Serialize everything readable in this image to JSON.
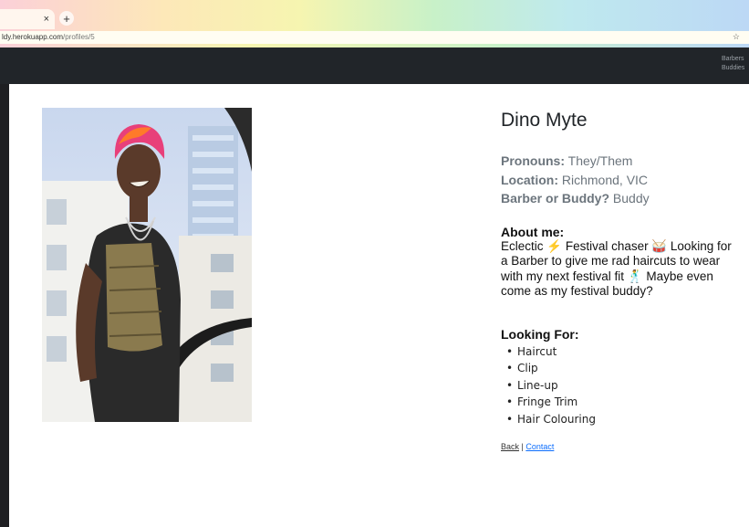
{
  "browser": {
    "tab_close": "×",
    "new_tab": "+",
    "url_host": "ldy.herokuapp.com",
    "url_path": "/profiles/5",
    "star": "☆"
  },
  "nav": {
    "links": [
      "Barbers",
      "Buddies"
    ]
  },
  "profile": {
    "name": "Dino Myte",
    "pronouns_label": "Pronouns:",
    "pronouns_value": "They/Them",
    "location_label": "Location:",
    "location_value": "Richmond, VIC",
    "role_label": "Barber or Buddy?",
    "role_value": "Buddy",
    "about_heading": "About me:",
    "about_text": "Eclectic ⚡ Festival chaser 🥁 Looking for a Barber to give me rad haircuts to wear with my next festival fit 🕺 Maybe even come as my festival buddy?",
    "looking_heading": "Looking For:",
    "looking_for": [
      "Haircut",
      "Clip",
      "Line-up",
      "Fringe Trim",
      "Hair Colouring"
    ]
  },
  "links": {
    "back": "Back",
    "separator": " | ",
    "contact": "Contact"
  }
}
